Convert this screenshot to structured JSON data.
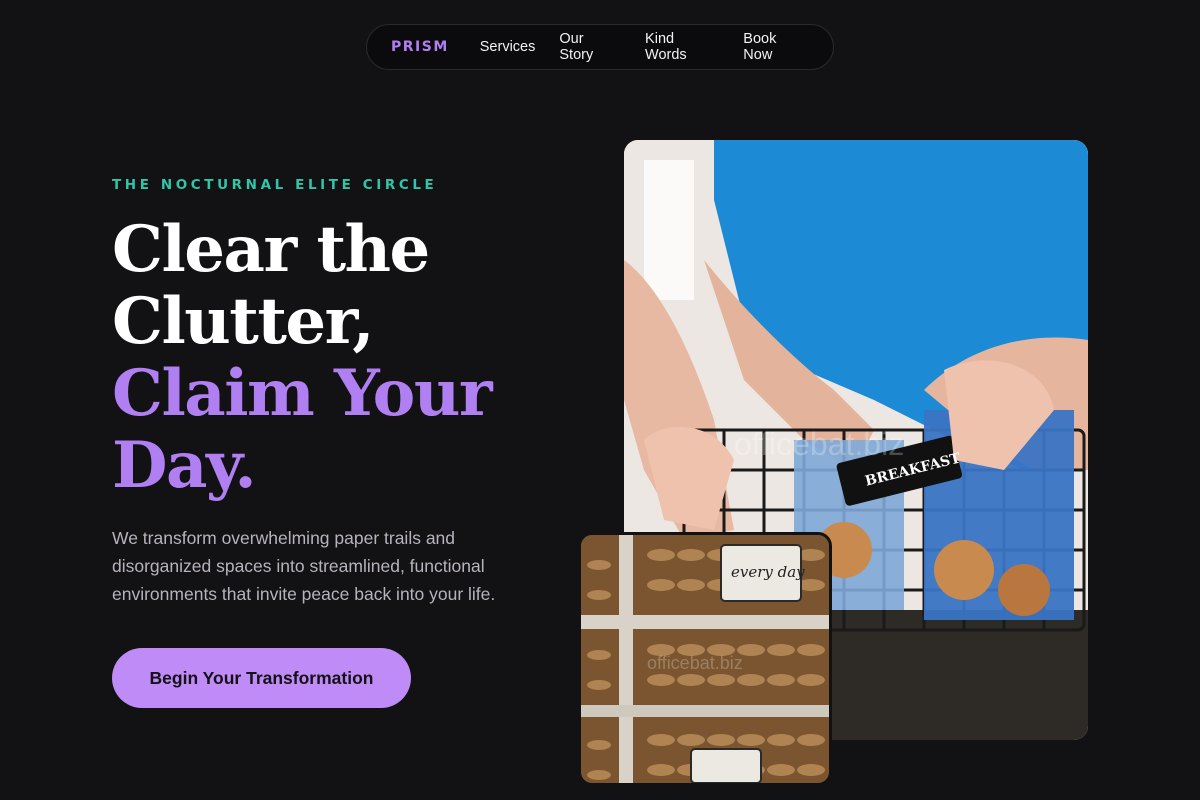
{
  "nav": {
    "logo": "PRISM",
    "links": [
      "Services",
      "Our Story",
      "Kind Words",
      "Book Now"
    ]
  },
  "hero": {
    "eyebrow": "THE NOCTURNAL ELITE CIRCLE",
    "headline_line1": "Clear the",
    "headline_line2": "Clutter,",
    "headline_line3": "Claim Your",
    "headline_line4": "Day.",
    "subtext": "We transform overwhelming paper trails and disorganized spaces into streamlined, functional environments that invite peace back into your life.",
    "cta_label": "Begin Your Transformation"
  },
  "images": {
    "main_label": "BREAKFAST",
    "small_label": "every day",
    "watermark": "officebat.biz"
  },
  "colors": {
    "background": "#121113",
    "accent_purple": "#b07ff2",
    "accent_teal": "#2fc6aa",
    "cta_bg": "#bf8bf7"
  }
}
